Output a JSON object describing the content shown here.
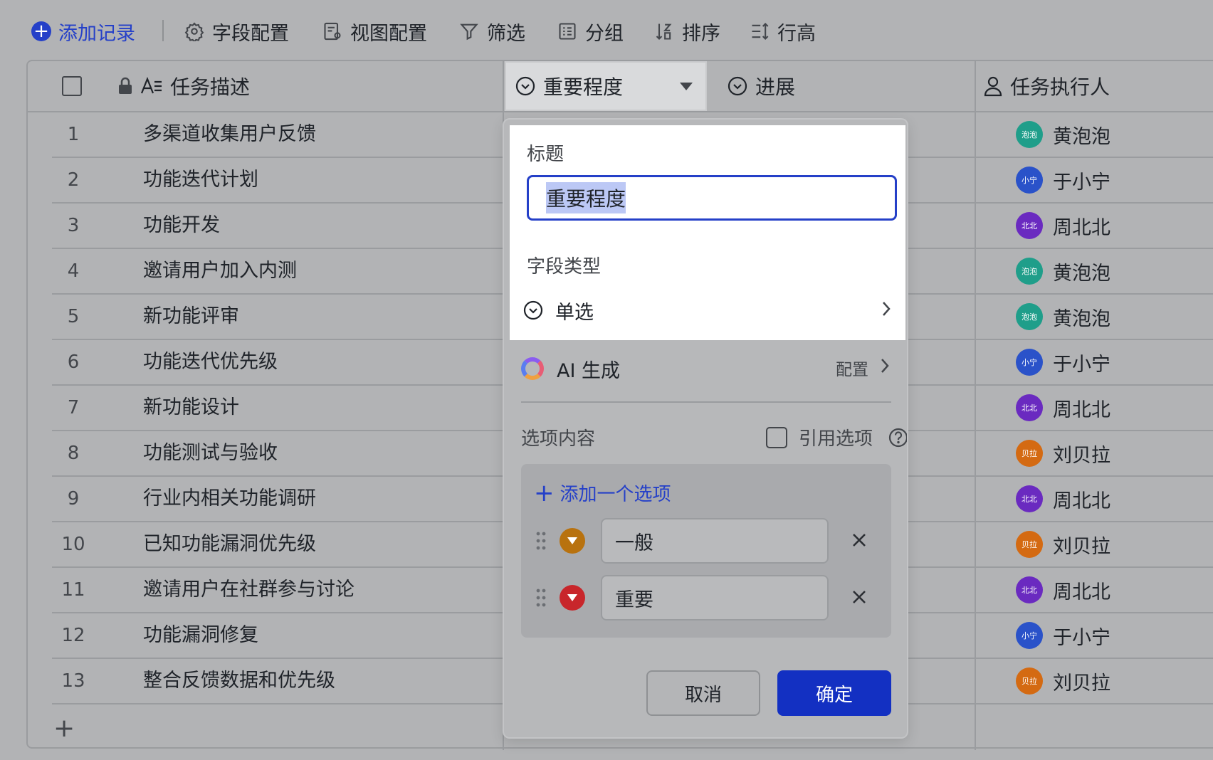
{
  "toolbar": {
    "add_record": "添加记录",
    "field_config": "字段配置",
    "view_config": "视图配置",
    "filter": "筛选",
    "group": "分组",
    "sort": "排序",
    "row_height": "行高"
  },
  "columns": {
    "task_desc": "任务描述",
    "importance": "重要程度",
    "progress": "进展",
    "assignee": "任务执行人"
  },
  "rows": [
    {
      "num": "1",
      "desc": "多渠道收集用户反馈",
      "person": "黄泡泡",
      "avatar": "泡泡",
      "color": "#1f9e8a"
    },
    {
      "num": "2",
      "desc": "功能迭代计划",
      "person": "于小宁",
      "avatar": "小宁",
      "color": "#2a52c9"
    },
    {
      "num": "3",
      "desc": "功能开发",
      "person": "周北北",
      "avatar": "北北",
      "color": "#6a2ac0"
    },
    {
      "num": "4",
      "desc": "邀请用户加入内测",
      "person": "黄泡泡",
      "avatar": "泡泡",
      "color": "#1f9e8a"
    },
    {
      "num": "5",
      "desc": "新功能评审",
      "person": "黄泡泡",
      "avatar": "泡泡",
      "color": "#1f9e8a"
    },
    {
      "num": "6",
      "desc": "功能迭代优先级",
      "person": "于小宁",
      "avatar": "小宁",
      "color": "#2a52c9"
    },
    {
      "num": "7",
      "desc": "新功能设计",
      "person": "周北北",
      "avatar": "北北",
      "color": "#6a2ac0"
    },
    {
      "num": "8",
      "desc": "功能测试与验收",
      "person": "刘贝拉",
      "avatar": "贝拉",
      "color": "#d46a12"
    },
    {
      "num": "9",
      "desc": "行业内相关功能调研",
      "person": "周北北",
      "avatar": "北北",
      "color": "#6a2ac0"
    },
    {
      "num": "10",
      "desc": "已知功能漏洞优先级",
      "person": "刘贝拉",
      "avatar": "贝拉",
      "color": "#d46a12"
    },
    {
      "num": "11",
      "desc": "邀请用户在社群参与讨论",
      "person": "周北北",
      "avatar": "北北",
      "color": "#6a2ac0"
    },
    {
      "num": "12",
      "desc": "功能漏洞修复",
      "person": "于小宁",
      "avatar": "小宁",
      "color": "#2a52c9"
    },
    {
      "num": "13",
      "desc": "整合反馈数据和优先级",
      "person": "刘贝拉",
      "avatar": "贝拉",
      "color": "#d46a12"
    }
  ],
  "popup": {
    "title_label": "标题",
    "title_value": "重要程度",
    "type_label": "字段类型",
    "type_value": "单选",
    "ai_label": "AI 生成",
    "ai_config": "配置",
    "options_label": "选项内容",
    "reference_label": "引用选项",
    "add_option": "添加一个选项",
    "options": [
      {
        "label": "一般",
        "color": "#b8720f"
      },
      {
        "label": "重要",
        "color": "#c8262b"
      }
    ],
    "cancel": "取消",
    "confirm": "确定"
  }
}
